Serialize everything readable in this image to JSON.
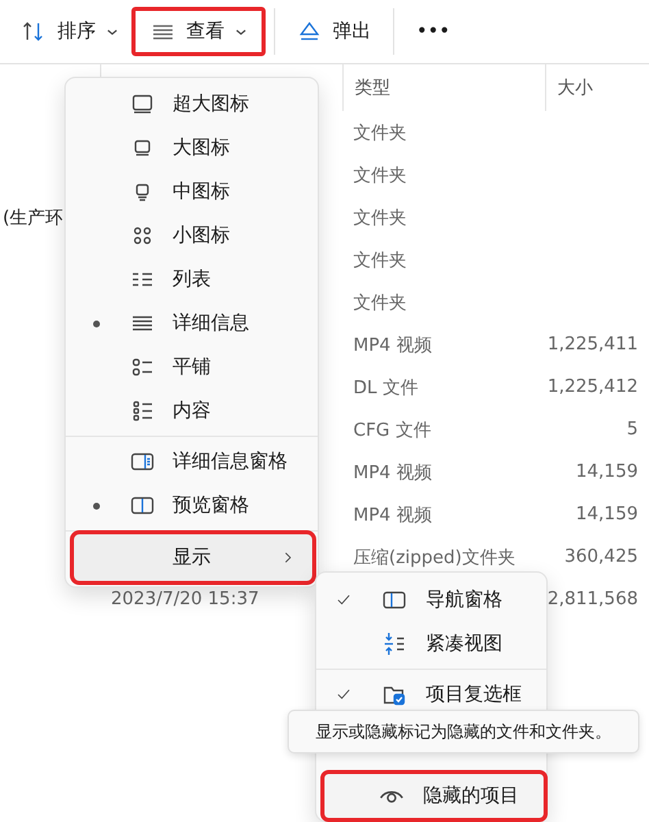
{
  "toolbar": [
    {
      "label": "排序",
      "dropdown": true,
      "highlighted": false
    },
    {
      "label": "查看",
      "dropdown": true,
      "highlighted": true
    },
    {
      "label": "弹出",
      "dropdown": false,
      "highlighted": false
    },
    {
      "label": "•••",
      "dropdown": false,
      "highlighted": false
    }
  ],
  "table": {
    "columns": [
      {
        "label": "类型"
      },
      {
        "label": "大小"
      }
    ],
    "rows": [
      {
        "type": "文件夹"
      },
      {
        "type": "文件夹"
      },
      {
        "name": "(生产环",
        "type": "文件夹"
      },
      {
        "type": "文件夹"
      },
      {
        "type": "文件夹"
      },
      {
        "type": "MP4 视频",
        "size": "1,225,411"
      },
      {
        "type": "DL 文件",
        "size": "1,225,412"
      },
      {
        "type": "CFG 文件",
        "size": "5"
      },
      {
        "type": "MP4 视频",
        "size": "14,159"
      },
      {
        "type": "MP4 视频",
        "size": "14,159"
      },
      {
        "type": "压缩(zipped)文件夹",
        "size": "360,425"
      },
      {
        "date": "2023/7/20 15:37",
        "size": "2,811,568"
      }
    ]
  },
  "view_menu": {
    "items": [
      {
        "label": "超大图标",
        "selected": false
      },
      {
        "label": "大图标",
        "selected": false
      },
      {
        "label": "中图标",
        "selected": false
      },
      {
        "label": "小图标",
        "selected": false
      },
      {
        "label": "列表",
        "selected": false
      },
      {
        "label": "详细信息",
        "selected": true
      },
      {
        "label": "平铺",
        "selected": false
      },
      {
        "label": "内容",
        "selected": false
      },
      {
        "label": "详细信息窗格",
        "selected": false
      },
      {
        "label": "预览窗格",
        "selected": true
      }
    ],
    "show": {
      "label": "显示",
      "highlighted": true
    }
  },
  "show_menu": {
    "items": [
      {
        "label": "导航窗格",
        "checked": true,
        "highlighted": false
      },
      {
        "label": "紧凑视图",
        "checked": false,
        "highlighted": false
      },
      {
        "label": "项目复选框",
        "checked": true,
        "highlighted": false
      },
      {
        "label": "隐藏的项目",
        "checked": false,
        "highlighted": true
      }
    ]
  },
  "tooltip": "显示或隐藏标记为隐藏的文件和文件夹。"
}
